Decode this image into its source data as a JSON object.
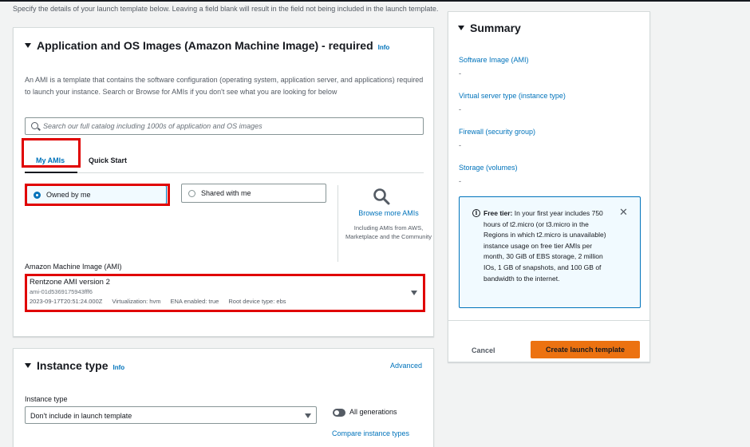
{
  "intro_text": "Specify the details of your launch template below. Leaving a field blank will result in the field not being included in the launch template.",
  "ami_section": {
    "title": "Application and OS Images (Amazon Machine Image) - required",
    "info": "Info",
    "description": "An AMI is a template that contains the software configuration (operating system, application server, and applications) required to launch your instance. Search or Browse for AMIs if you don't see what you are looking for below",
    "search_placeholder": "Search our full catalog including 1000s of application and OS images",
    "tabs": [
      {
        "label": "My AMIs",
        "active": true
      },
      {
        "label": "Quick Start",
        "active": false
      }
    ],
    "radio_owned": "Owned by me",
    "radio_shared": "Shared with me",
    "browse_label": "Browse more AMIs",
    "browse_sub": "Including AMIs from AWS, Marketplace and the Community",
    "ami_label": "Amazon Machine Image (AMI)",
    "selected_ami": {
      "name": "Rentzone AMI version 2",
      "id": "ami-01d5369175943fff6",
      "created": "2023-09-17T20:51:24.000Z",
      "virtualization": "Virtualization: hvm",
      "ena": "ENA enabled: true",
      "root_device": "Root device type: ebs"
    }
  },
  "instance_section": {
    "title": "Instance type",
    "info": "Info",
    "advanced": "Advanced",
    "label": "Instance type",
    "value": "Don't include in launch template",
    "all_generations": "All generations",
    "compare": "Compare instance types"
  },
  "summary": {
    "title": "Summary",
    "items": [
      {
        "label": "Software Image (AMI)",
        "value": "-"
      },
      {
        "label": "Virtual server type (instance type)",
        "value": "-"
      },
      {
        "label": "Firewall (security group)",
        "value": "-"
      },
      {
        "label": "Storage (volumes)",
        "value": "-"
      }
    ],
    "free_tier_title": "Free tier:",
    "free_tier_text": "In your first year includes 750 hours of t2.micro (or t3.micro in the Regions in which t2.micro is unavailable) instance usage on free tier AMIs per month, 30 GiB of EBS storage, 2 million IOs, 1 GB of snapshots, and 100 GB of bandwidth to the internet.",
    "cancel": "Cancel",
    "create": "Create launch template"
  },
  "colors": {
    "link": "#0073bb",
    "primary_button": "#ec7211",
    "highlight": "#e00000"
  }
}
